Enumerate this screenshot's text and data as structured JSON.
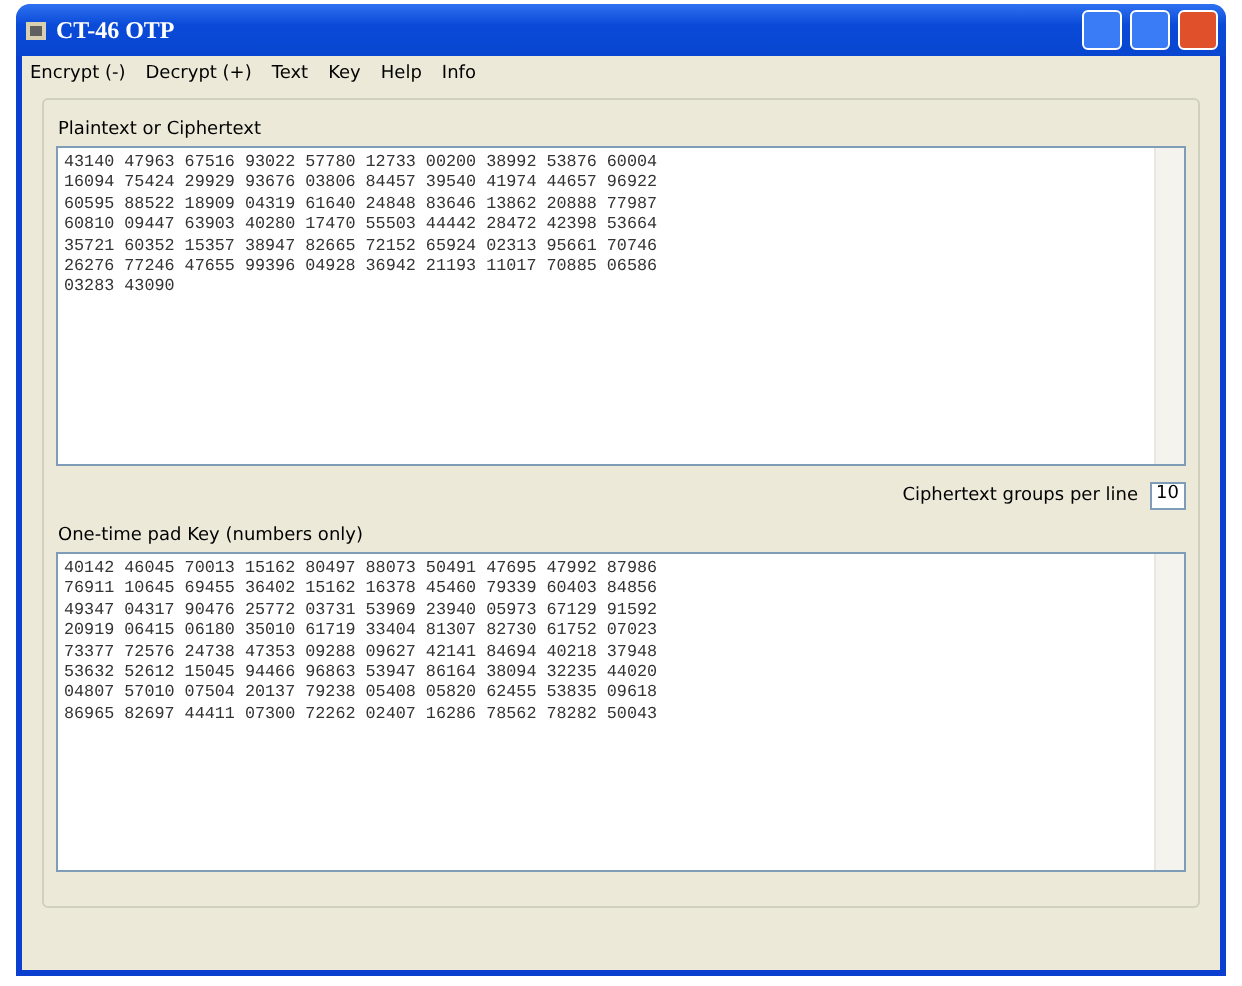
{
  "window": {
    "title": "CT-46 OTP"
  },
  "menu": [
    "Encrypt (-)",
    "Decrypt (+)",
    "Text",
    "Key",
    "Help",
    "Info"
  ],
  "text_panel": {
    "label": "Plaintext or Ciphertext",
    "lines": [
      "43140 47963 67516 93022 57780 12733 00200 38992 53876 60004",
      "16094 75424 29929 93676 03806 84457 39540 41974 44657 96922",
      "60595 88522 18909 04319 61640 24848 83646 13862 20888 77987",
      "60810 09447 63903 40280 17470 55503 44442 28472 42398 53664",
      "35721 60352 15357 38947 82665 72152 65924 02313 95661 70746",
      "26276 77246 47655 99396 04928 36942 21193 11017 70885 06586",
      "03283 43090"
    ]
  },
  "groups_per_line": {
    "label": "Ciphertext groups per line",
    "value": "10"
  },
  "key_panel": {
    "label": "One-time pad Key (numbers only)",
    "lines": [
      "40142 46045 70013 15162 80497 88073 50491 47695 47992 87986",
      "76911 10645 69455 36402 15162 16378 45460 79339 60403 84856",
      "49347 04317 90476 25772 03731 53969 23940 05973 67129 91592",
      "20919 06415 06180 35010 61719 33404 81307 82730 61752 07023",
      "73377 72576 24738 47353 09288 09627 42141 84694 40218 37948",
      "53632 52612 15045 94466 96863 53947 86164 38094 32235 44020",
      "04807 57010 07504 20137 79238 05408 05820 62455 53835 09618",
      "86965 82697 44411 07300 72262 02407 16286 78562 78282 50043"
    ]
  }
}
